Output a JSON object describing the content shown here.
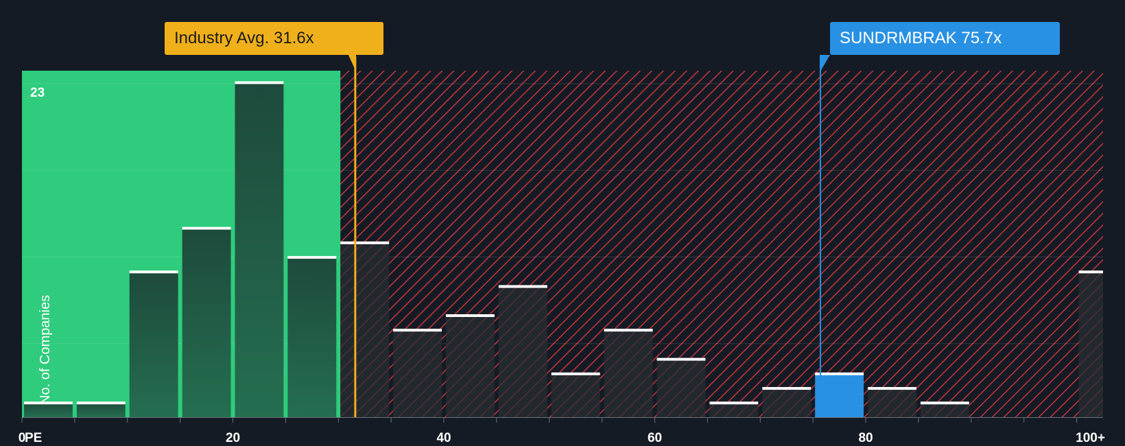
{
  "chart_data": {
    "type": "bar",
    "x_axis_title": "PE",
    "ylabel": "No. of Companies",
    "y_max_label": "23",
    "ylim": [
      0,
      23.8
    ],
    "xlim": [
      0,
      102.5
    ],
    "x_ticks": [
      {
        "value": 0,
        "label": "0"
      },
      {
        "value": 20,
        "label": "20"
      },
      {
        "value": 40,
        "label": "40"
      },
      {
        "value": 60,
        "label": "60"
      },
      {
        "value": 80,
        "label": "80"
      },
      {
        "value": 100,
        "label": "100+"
      }
    ],
    "bins": [
      {
        "start": 0,
        "end": 5,
        "count": 1
      },
      {
        "start": 5,
        "end": 10,
        "count": 1
      },
      {
        "start": 10,
        "end": 15,
        "count": 10
      },
      {
        "start": 15,
        "end": 20,
        "count": 13
      },
      {
        "start": 20,
        "end": 25,
        "count": 23
      },
      {
        "start": 25,
        "end": 30,
        "count": 11
      },
      {
        "start": 30,
        "end": 35,
        "count": 12
      },
      {
        "start": 35,
        "end": 40,
        "count": 6
      },
      {
        "start": 40,
        "end": 45,
        "count": 7
      },
      {
        "start": 45,
        "end": 50,
        "count": 9
      },
      {
        "start": 50,
        "end": 55,
        "count": 3
      },
      {
        "start": 55,
        "end": 60,
        "count": 6
      },
      {
        "start": 60,
        "end": 65,
        "count": 4
      },
      {
        "start": 65,
        "end": 70,
        "count": 1
      },
      {
        "start": 70,
        "end": 75,
        "count": 2
      },
      {
        "start": 75,
        "end": 80,
        "count": 3,
        "highlight": true
      },
      {
        "start": 80,
        "end": 85,
        "count": 2
      },
      {
        "start": 85,
        "end": 90,
        "count": 1
      },
      {
        "start": 90,
        "end": 95,
        "count": 0
      },
      {
        "start": 95,
        "end": 100,
        "count": 0
      },
      {
        "start": 100,
        "end": 102.5,
        "count": 10
      }
    ],
    "industry_avg": {
      "value": 31.6,
      "label": "Industry Avg. 31.6x"
    },
    "company": {
      "value": 75.7,
      "label": "SUNDRMBRAK 75.7x"
    },
    "fair_zone_end": 30.2,
    "colors": {
      "background": "#151b24",
      "fair_zone": "#2ecc7c",
      "overvalued_zone": "#c7353d",
      "bar": "#1e4a3c",
      "bar_dark": "#222a30",
      "bar_cap": "#ffffff",
      "highlight_bar": "#2991e3",
      "industry_line": "#f0b01b",
      "company_line": "#2991e3"
    }
  }
}
